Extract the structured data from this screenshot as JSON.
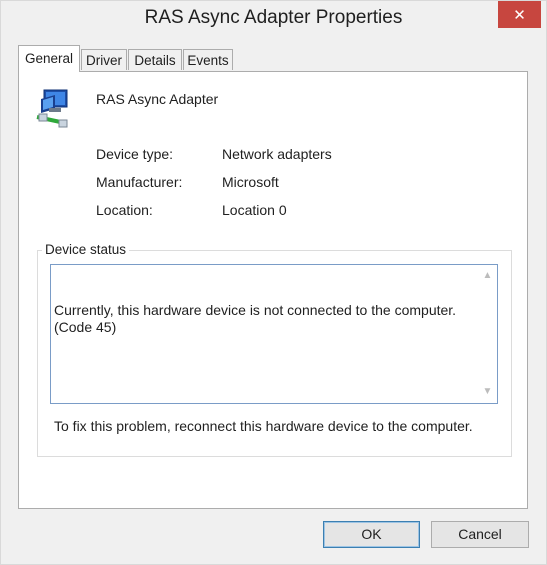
{
  "window": {
    "title": "RAS Async Adapter Properties",
    "close_glyph": "✕"
  },
  "tabs": [
    {
      "label": "General",
      "active": true
    },
    {
      "label": "Driver",
      "active": false
    },
    {
      "label": "Details",
      "active": false
    },
    {
      "label": "Events",
      "active": false
    }
  ],
  "device": {
    "name": "RAS Async Adapter",
    "icon": "network-adapter-icon",
    "type_label": "Device type:",
    "type_value": "Network adapters",
    "manufacturer_label": "Manufacturer:",
    "manufacturer_value": "Microsoft",
    "location_label": "Location:",
    "location_value": "Location 0"
  },
  "status": {
    "group_title": "Device status",
    "line1": "Currently, this hardware device is not connected to the computer. (Code 45)",
    "line2": "To fix this problem, reconnect this hardware device to the computer."
  },
  "buttons": {
    "ok": "OK",
    "cancel": "Cancel"
  },
  "colors": {
    "close_button": "#c7463f",
    "focus_border": "#3c7fb1"
  }
}
